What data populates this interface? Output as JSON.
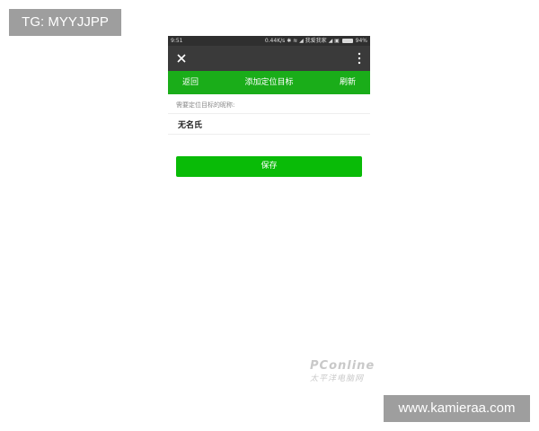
{
  "overlays": {
    "tag": "TG: MYYJJPP",
    "site": "www.kamieraa.com",
    "watermark_top": "PConline",
    "watermark_bottom": "太平洋电脑网"
  },
  "status_bar": {
    "time": "9:51",
    "speed": "0.44K/s",
    "carrier": "我爱我家",
    "battery": "94%"
  },
  "header": {
    "close_icon": "close-icon",
    "more_icon": "more-vertical-icon"
  },
  "nav": {
    "back_label": "返回",
    "title": "添加定位目标",
    "refresh_label": "刷新"
  },
  "form": {
    "label": "需要定位目标的昵称:",
    "name_value": "无名氏"
  },
  "actions": {
    "save_label": "保存"
  },
  "colors": {
    "green_bar": "#1aad19",
    "save_button": "#09bb07",
    "title_bar": "#3a3a3a",
    "status_bar": "#2f2f2f"
  }
}
